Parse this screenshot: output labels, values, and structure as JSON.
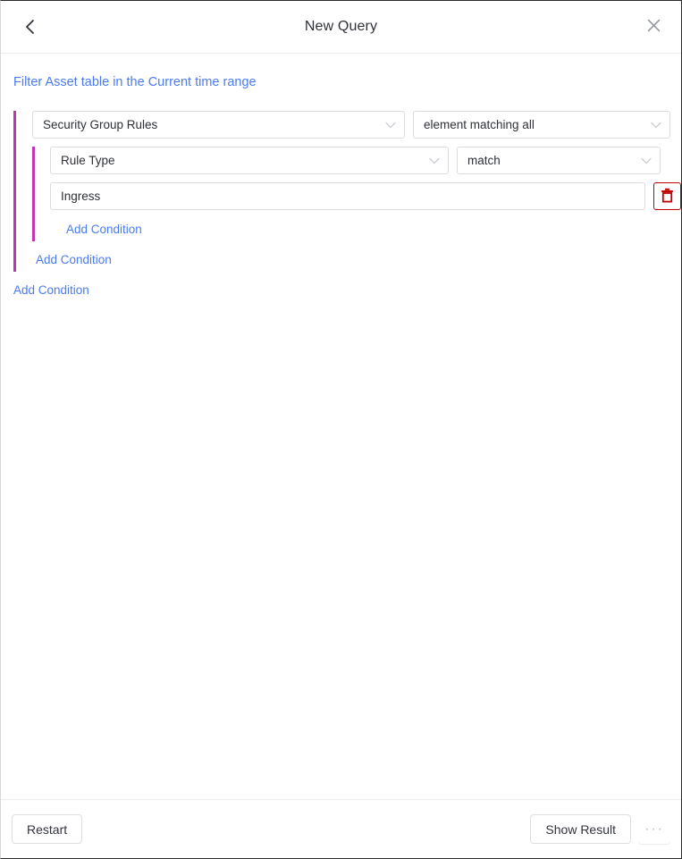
{
  "window": {
    "title": "New Query"
  },
  "header": {
    "back_icon": "chevron-left-icon",
    "close_icon": "close-x-icon"
  },
  "subtitle": {
    "text": "Filter Asset table in the Current time range"
  },
  "query": {
    "outer_group": {
      "accent_color": "#c034b8",
      "field_select": {
        "value": "Security Group Rules",
        "chevron": "chevron-down-icon"
      },
      "quantifier_select": {
        "value": "element matching all",
        "chevron": "chevron-down-icon"
      },
      "inner_group": {
        "accent_color": "#c034b8",
        "attribute_select": {
          "value": "Rule Type",
          "chevron": "chevron-down-icon"
        },
        "operator_select": {
          "value": "match",
          "chevron": "chevron-down-icon"
        },
        "value_input": {
          "value": "Ingress",
          "placeholder": ""
        },
        "delete_button": {
          "icon": "trash-icon",
          "color": "#c00000"
        },
        "add_condition_label": "Add Condition"
      },
      "add_condition_label": "Add Condition"
    },
    "root_add_condition_label": "Add Condition"
  },
  "footer": {
    "restart_label": "Restart",
    "show_result_label": "Show Result",
    "more_label": "···",
    "more_icon": "ellipsis-icon"
  },
  "colors": {
    "link": "#4a7bf0",
    "group_accent": "#c034b8",
    "danger": "#c00000"
  }
}
